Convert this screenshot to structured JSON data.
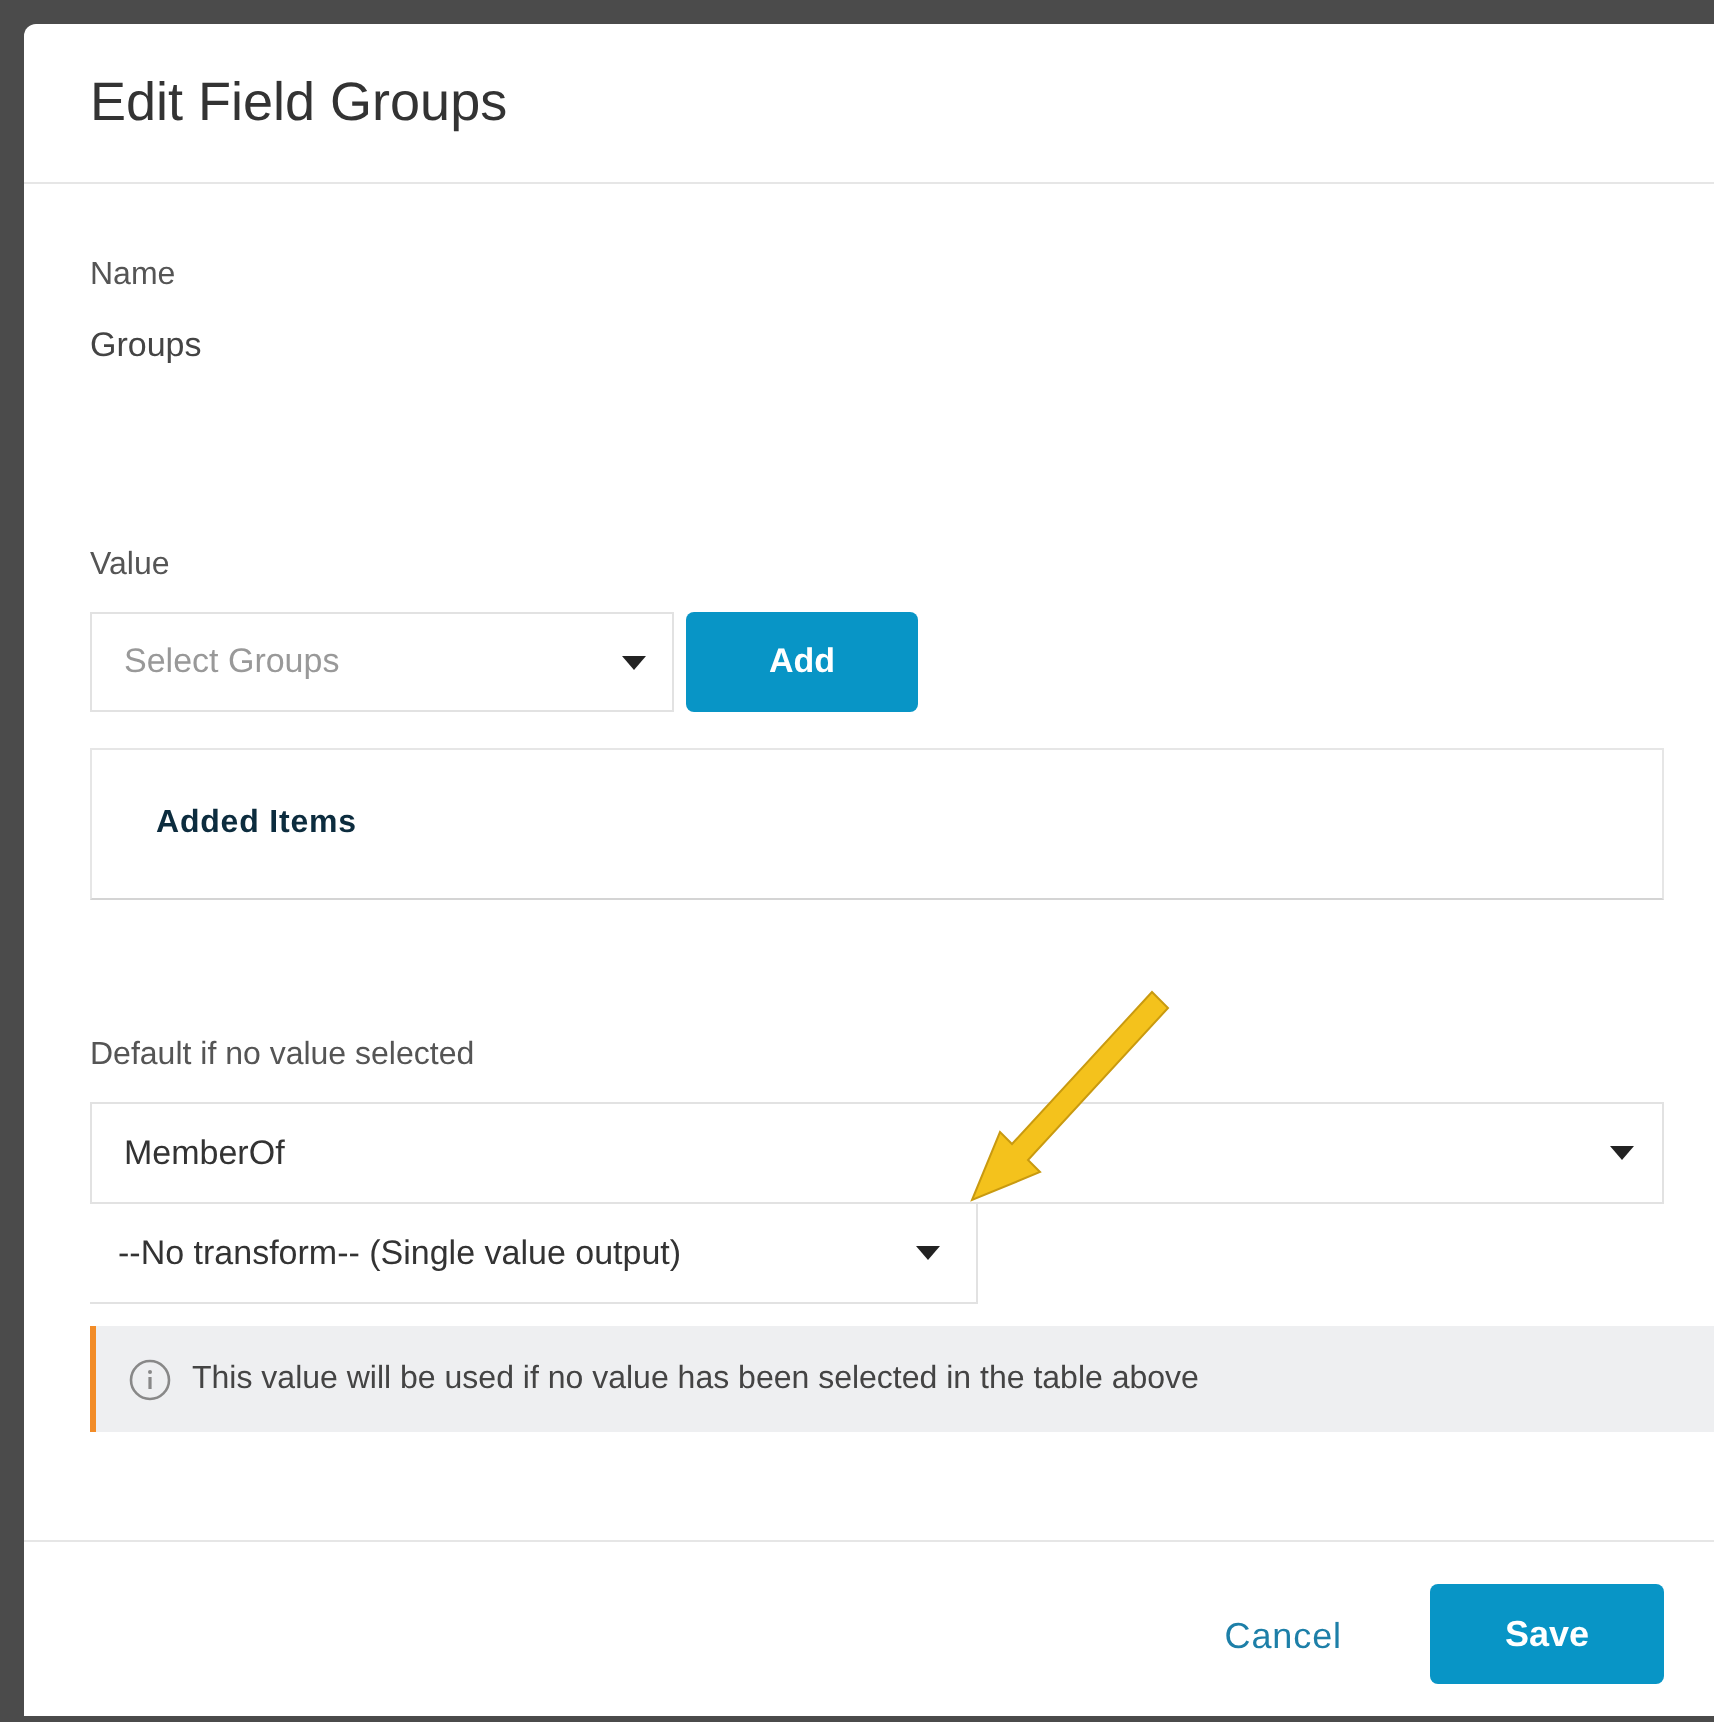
{
  "dialog": {
    "title": "Edit Field Groups"
  },
  "name_field": {
    "label": "Name",
    "value": "Groups"
  },
  "value_field": {
    "label": "Value",
    "placeholder": "Select Groups",
    "button": "Add"
  },
  "added_items": {
    "heading": "Added Items"
  },
  "default_field": {
    "label": "Default if no value selected",
    "value": "MemberOf",
    "transform": "--No transform-- (Single value output)"
  },
  "info": {
    "text": "This value will be used if no value has been selected in the table above"
  },
  "buttons": [
    {
      "label": "Cancel",
      "kind": "secondary"
    },
    {
      "label": "Save",
      "kind": "primary"
    }
  ]
}
